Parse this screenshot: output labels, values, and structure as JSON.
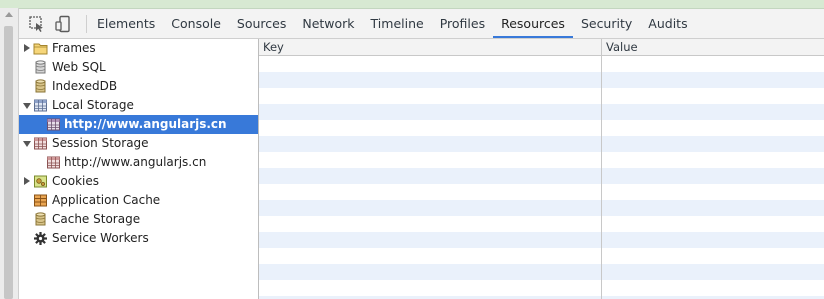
{
  "toolbar": {
    "inspect_icon": "inspect-element-icon",
    "device_icon": "device-mode-icon",
    "tabs": [
      {
        "label": "Elements",
        "active": false
      },
      {
        "label": "Console",
        "active": false
      },
      {
        "label": "Sources",
        "active": false
      },
      {
        "label": "Network",
        "active": false
      },
      {
        "label": "Timeline",
        "active": false
      },
      {
        "label": "Profiles",
        "active": false
      },
      {
        "label": "Resources",
        "active": true
      },
      {
        "label": "Security",
        "active": false
      },
      {
        "label": "Audits",
        "active": false
      }
    ]
  },
  "sidebar": {
    "items": [
      {
        "label": "Frames",
        "icon": "folder-icon",
        "arrow": "collapsed",
        "depth": 0
      },
      {
        "label": "Web SQL",
        "icon": "database-icon",
        "arrow": "none",
        "depth": 0
      },
      {
        "label": "IndexedDB",
        "icon": "database-icon",
        "arrow": "none",
        "depth": 0
      },
      {
        "label": "Local Storage",
        "icon": "storage-table-icon",
        "arrow": "expanded",
        "depth": 0
      },
      {
        "label": "http://www.angularjs.cn",
        "icon": "storage-table-icon",
        "arrow": "none",
        "depth": 1,
        "selected": true
      },
      {
        "label": "Session Storage",
        "icon": "storage-table-icon",
        "arrow": "expanded",
        "depth": 0
      },
      {
        "label": "http://www.angularjs.cn",
        "icon": "storage-table-icon",
        "arrow": "none",
        "depth": 1
      },
      {
        "label": "Cookies",
        "icon": "cookie-icon",
        "arrow": "collapsed",
        "depth": 0
      },
      {
        "label": "Application Cache",
        "icon": "application-cache-icon",
        "arrow": "none",
        "depth": 0
      },
      {
        "label": "Cache Storage",
        "icon": "database-icon",
        "arrow": "none",
        "depth": 0
      },
      {
        "label": "Service Workers",
        "icon": "gear-icon",
        "arrow": "none",
        "depth": 0
      }
    ]
  },
  "grid": {
    "columns": [
      "Key",
      "Value"
    ],
    "rows": []
  },
  "colors": {
    "accent": "#3879d9",
    "stripe": "#eaf1fb",
    "toolbar_bg": "#f3f3f3"
  }
}
